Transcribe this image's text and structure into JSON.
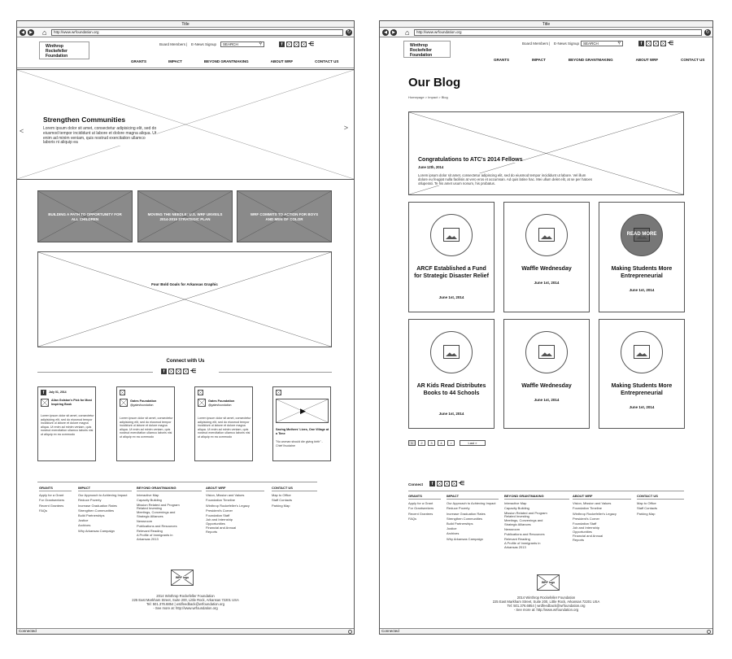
{
  "window_title": "Title",
  "url": "http://www.wrfoundation.org",
  "status_text": "Connected",
  "logo_text": [
    "Winthrop",
    "Rockefeller",
    "Foundation"
  ],
  "util_links": {
    "board": "Board Members",
    "enews": "E-News Signup",
    "search_placeholder": "SEARCH"
  },
  "nav": [
    "GRANTS",
    "IMPACT",
    "BEYOND GRANTMAKING",
    "ABOUT WRF",
    "CONTACT US"
  ],
  "home": {
    "hero_title": "Strengthen Communities",
    "hero_body": "Lorem ipsum dolor sit amet, consectetur adipisicing elit, sed do eiusmod tempor incididunt ut labore et dolore magna aliqua. Ut enim ad minim veniam, quis nostrud exercitation ullamco laboris ni aliquip ea",
    "prev": "<",
    "next": ">",
    "tiles": [
      "BUILDING A PATH TO OPPORTUNITY FOR ALL CHILDREN",
      "MOVING THE NEEDLE: U.S. WRF UNVEILS 2014-2015 STRATEGIC PLAN",
      "WRF COMMITS TO ACTION FOR BOYS AND MEN OF COLOR"
    ],
    "graphic_label": "Four Bold Goals for Arkansas Graphic",
    "connect_title": "Connect with Us",
    "social_cards": [
      {
        "date": "July 01, 2014",
        "title": "Allan Golston's Pick for Most Inspiring Book",
        "body": "Lorem ipsum dolor sit amet, consectetur adipisicing elit, sed do eiusmod tempor incididunt ut labore et dolore magna aliqua. Ut enim ad minim veniam, quis nostrud exercitation ullamco laboris nisi ut aliquip ex ea commodo"
      },
      {
        "title": "Gates Foundation",
        "handle": "@gatesfoundation",
        "body": "Lorem ipsum dolor sit amet, consectetur adipisicing elit, sed do eiusmod tempor incididunt ut labore et dolore magna aliqua. Ut enim ad minim veniam, quis nostrud exercitation ullamco laboris nisi ut aliquip ex ea commodo"
      },
      {
        "title": "Gates Foundation",
        "handle": "@gatesfoundation",
        "body": "Lorem ipsum dolor sit amet, consectetur adipisicing elit, sed do eiusmod tempor incididunt ut labore et dolore magna aliqua. Ut enim ad minim veniam, quis nostrud exercitation ullamco laboris nisi ut aliquip ex ea commodo"
      },
      {
        "title": "Saving Mothers' Lives, One Village at a Time",
        "quote": "\"No woman should die giving birth\" - Chief Ihuoiaine"
      }
    ]
  },
  "footer": {
    "columns": [
      {
        "head": "GRANTS",
        "items": [
          "Apply for a Grant",
          "For Grantseekers",
          "Recent Grantees",
          "FAQs"
        ]
      },
      {
        "head": "IMPACT",
        "items": [
          "Our Approach to Achieving Impact",
          "Reduce Poverty",
          "Increase Graduation Rates",
          "Strengthen Communities",
          "Build Partnerships",
          "Justice",
          "Archives",
          "Why Arkansas Campaign"
        ]
      },
      {
        "head": "BEYOND GRANTMAKING",
        "items": [
          "Interactive Map",
          "Capacity Building",
          "Mission Related and Program Related Investing",
          "Meetings, Convenings and Strategic Alliances",
          "Newsroom",
          "Publications and Resources",
          "Relevant Reading",
          "A Profile of Immigrants in Arkansas 2013"
        ]
      },
      {
        "head": "ABOUT WRF",
        "items": [
          "Vision, Mission and Values",
          "Foundation Timeline",
          "Winthrop Rockefeller's Legacy",
          "President's Corner",
          "Foundation Staff",
          "Job and Internship Opportunities",
          "Financial and Annual Reports"
        ]
      },
      {
        "head": "CONTACT US",
        "items": [
          "Map to Office",
          "Staff Contacts",
          "Parking Map"
        ]
      }
    ],
    "logo_label": "WRF logo",
    "address": [
      "2014 Winthrop Rockefeller Foundation",
      "225 East Markham Street, Suite 200, Little Rock, Arkansas 72201 USA",
      "Tel: 501.376.6854 | wrdfeedback@wrfoundation.org",
      "- See more at: http://www.wrfoundation.org"
    ]
  },
  "blog": {
    "title": "Our Blog",
    "breadcrumb": "Homepage > Impact > Blog",
    "featured_title": "Congratulations to ATC's 2014 Fellows",
    "featured_date": "June 12th, 2014",
    "featured_body": "Lorem ipsum dolor sit amet, consectetur adipiscing elit, sed do eiusmod tempor incididunt ut labore. Vel illum dolore eu feugiat nulla facilisis at vero eros et accumsan. Ad quis latine hac. Mei ullum delet elit, at se per hatoes otluperati. Te his amet usum nonum, his probatus.",
    "read_more": "READ MORE",
    "posts": [
      {
        "title": "ARCF Established a Fund for Strategic Disaster Relief",
        "date": "June 1st, 2014"
      },
      {
        "title": "Waffle Wednesday",
        "date": "June 1st, 2014"
      },
      {
        "title": "Making Students More Entrepreneurial",
        "date": "June 1st, 2014"
      },
      {
        "title": "AR Kids Read Distributes Books to 44 Schools",
        "date": "June 1st, 2014"
      },
      {
        "title": "Waffle Wednesday",
        "date": "June 1st, 2014"
      },
      {
        "title": "Making Students More Entrepreneurial",
        "date": "June 1st, 2014"
      }
    ],
    "pagination": [
      "1",
      "2",
      "3",
      "4",
      ">",
      "Last »"
    ],
    "connect_label": "Connect"
  }
}
